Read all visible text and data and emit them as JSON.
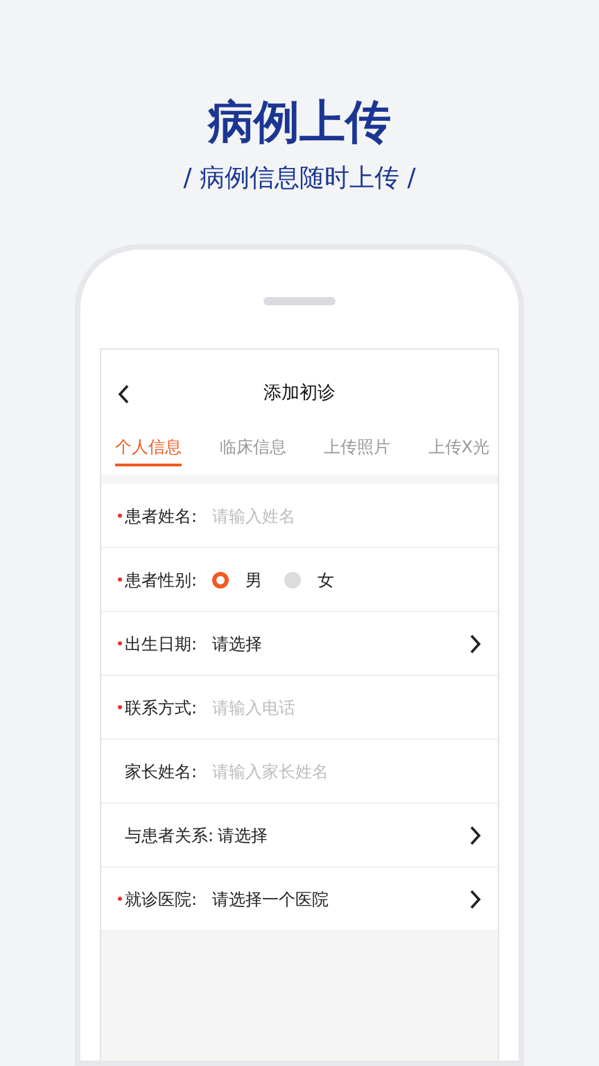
{
  "headline": "病例上传",
  "tagline": "/ 病例信息随时上传 /",
  "screen": {
    "title": "添加初诊",
    "tabs": [
      {
        "label": "个人信息",
        "selected": true
      },
      {
        "label": "临床信息",
        "selected": false
      },
      {
        "label": "上传照片",
        "selected": false
      },
      {
        "label": "上传X光",
        "selected": false
      }
    ],
    "fields": [
      {
        "kind": "input",
        "label": "患者姓名:",
        "required": true,
        "placeholder": "请输入姓名"
      },
      {
        "kind": "radio",
        "label": "患者性别:",
        "required": true,
        "options": [
          {
            "label": "男",
            "selected": true
          },
          {
            "label": "女",
            "selected": false
          }
        ]
      },
      {
        "kind": "select",
        "label": "出生日期:",
        "required": true,
        "value": "请选择"
      },
      {
        "kind": "input",
        "label": "联系方式:",
        "required": true,
        "placeholder": "请输入电话"
      },
      {
        "kind": "input",
        "label": "家长姓名:",
        "required": false,
        "placeholder": "请输入家长姓名"
      },
      {
        "kind": "select",
        "label": "与患者关系:",
        "required": false,
        "value": "请选择"
      },
      {
        "kind": "select",
        "label": "就诊医院:",
        "required": true,
        "value": "请选择一个医院"
      }
    ]
  }
}
